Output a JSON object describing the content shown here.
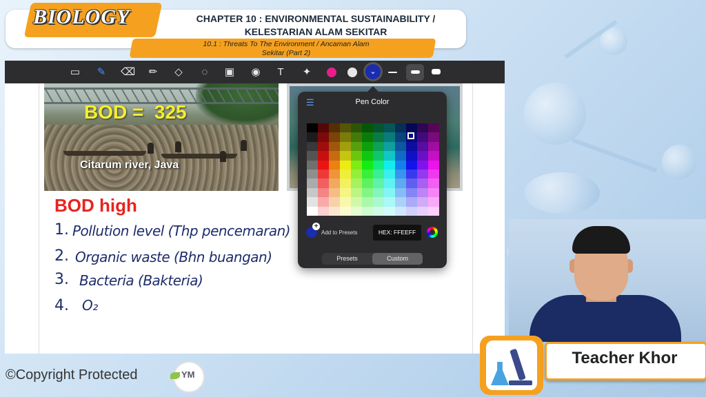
{
  "header": {
    "subject": "BIOLOGY",
    "chapter_line1": "CHAPTER 10 : ENVIRONMENTAL SUSTAINABILITY /",
    "chapter_line2": "KELESTARIAN ALAM SEKITAR",
    "section_line1": "10.1 : Threats To The Environment / Ancaman Alam",
    "section_line2": "Sekitar (Part 2)"
  },
  "toolbar": {
    "tools": [
      "page-icon",
      "pen-icon",
      "eraser-icon",
      "highlighter-icon",
      "shapes-icon",
      "lasso-icon",
      "image-icon",
      "camera-icon",
      "text-icon",
      "laser-pointer-icon"
    ],
    "colors": [
      "#e91e8c",
      "#e6e6e6",
      "#1a2cb0"
    ]
  },
  "slide": {
    "bod_value": "BOD =  325",
    "photo_caption": "Citarum river, Java",
    "bod_high": "BOD high",
    "notes": [
      {
        "num": "1.",
        "text": "Pollution level (Thp pencemaran)"
      },
      {
        "num": "2.",
        "text": "Organic waste (Bhn buangan)"
      },
      {
        "num": "3.",
        "text": "Bacteria (Bakteria)"
      },
      {
        "num": "4.",
        "text": "O₂"
      }
    ]
  },
  "pen_color": {
    "title": "Pen Color",
    "add_presets": "Add to Presets",
    "hex": "HEX:  FFEEFF",
    "tabs": [
      "Presets",
      "Custom"
    ],
    "active_tab": "Custom",
    "selected_color": "#1a2cb0"
  },
  "footer": {
    "copyright": "©Copyright Protected",
    "logo_text": "YM"
  },
  "presenter": {
    "name": "Teacher Khor"
  }
}
